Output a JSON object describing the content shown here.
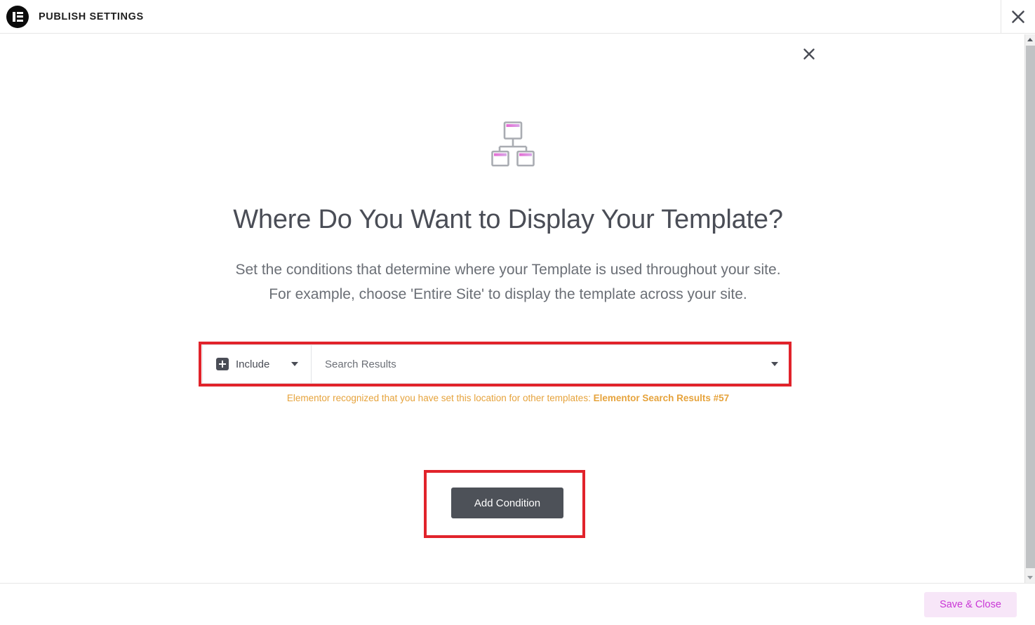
{
  "header": {
    "logo_icon": "elementor-logo-icon",
    "title": "PUBLISH SETTINGS",
    "close_icon": "close-icon"
  },
  "main": {
    "hero_icon": "sitemap-icon",
    "title": "Where Do You Want to Display Your Template?",
    "description_line1": "Set the conditions that determine where your Template is used throughout your site.",
    "description_line2": "For example, choose 'Entire Site' to display the template across your site.",
    "condition": {
      "type_icon": "plus-square-icon",
      "type_value": "Include",
      "type_caret_icon": "chevron-down-icon",
      "target_value": "Search Results",
      "target_caret_icon": "chevron-down-icon",
      "remove_icon": "close-icon"
    },
    "notice": {
      "text": "Elementor recognized that you have set this location for other templates: ",
      "link_text": "Elementor Search Results #57"
    },
    "add_condition_label": "Add Condition"
  },
  "footer": {
    "save_close_label": "Save & Close"
  },
  "scrollbar": {
    "up_icon": "triangle-up-icon",
    "down_icon": "triangle-down-icon"
  },
  "colors": {
    "accent_magenta": "#c936d6",
    "notice_orange": "#e6a33c",
    "annotation_red": "#e1232b",
    "button_slate": "#4d5158",
    "text_dark": "#4a4d56"
  }
}
